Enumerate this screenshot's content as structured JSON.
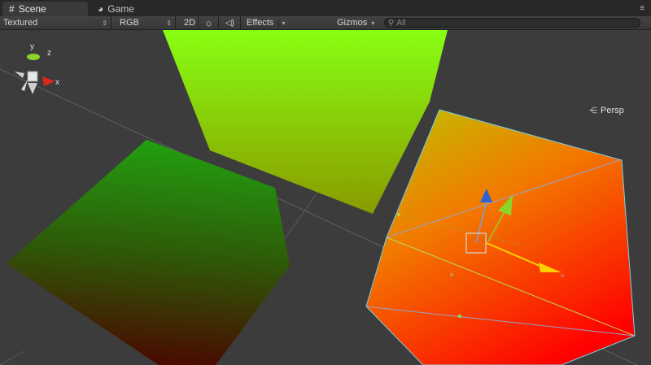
{
  "tabs": [
    {
      "label": "Scene",
      "icon": "grid-icon",
      "active": true
    },
    {
      "label": "Game",
      "icon": "pacman-icon",
      "active": false
    }
  ],
  "toolbar": {
    "render_mode": "Textured",
    "channel_mode": "RGB",
    "mode_2d": "2D",
    "lighting_icon": "sun-icon",
    "audio_icon": "speaker-icon",
    "effects_label": "Effects",
    "gizmos_label": "Gizmos",
    "search_placeholder": "All"
  },
  "scene": {
    "projection_label": "Persp",
    "axes": {
      "x": "x",
      "y": "y",
      "z": "z"
    }
  },
  "colors": {
    "tab_bg": "#282828",
    "viewport_bg": "#3c3c3c",
    "axis_x": "#d62a1e",
    "axis_y": "#8dd42a",
    "axis_z": "#2b63d6",
    "selection_outline": "#7fd0e0"
  }
}
